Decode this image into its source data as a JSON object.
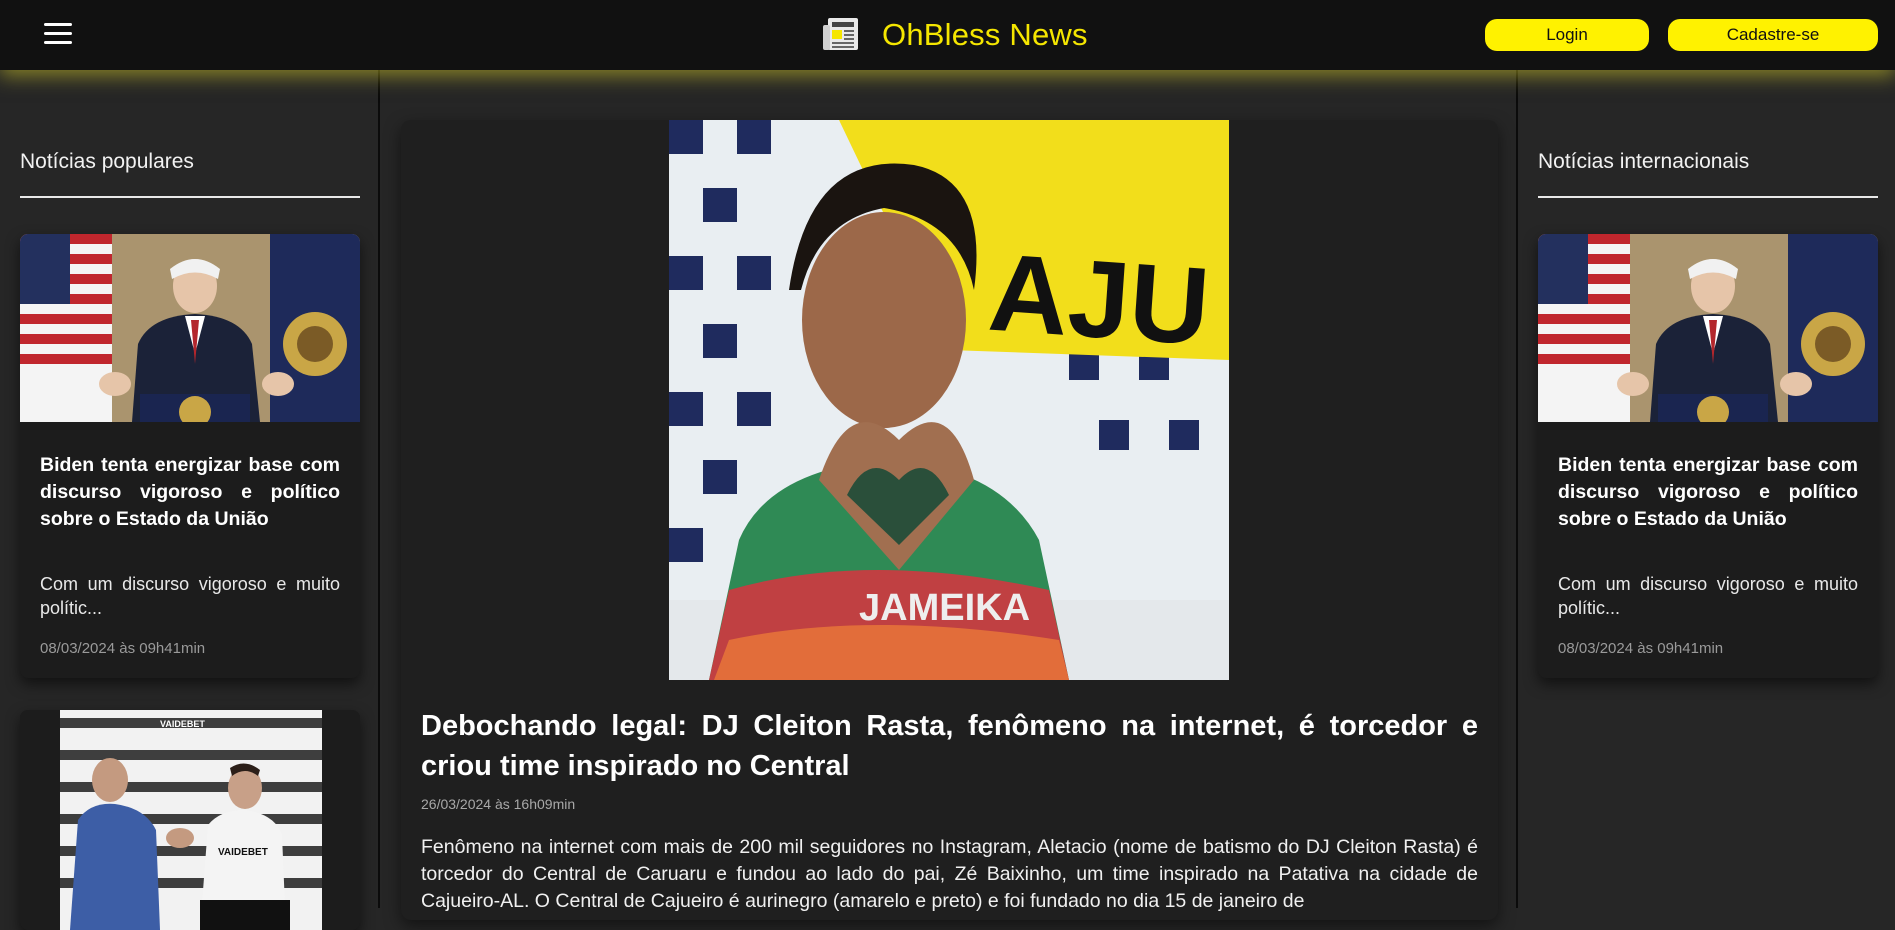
{
  "header": {
    "brand_title": "OhBless News",
    "login_label": "Login",
    "signup_label": "Cadastre-se",
    "accent_color": "#fff200",
    "icons": [
      "menu-icon",
      "newspaper-icon"
    ]
  },
  "left_column": {
    "section_title": "Notícias populares",
    "cards": [
      {
        "title": "Biden tenta energizar base com discurso vigoroso e político sobre o Estado da União",
        "excerpt": "Com um discurso vigoroso e muito polític...",
        "date": "08/03/2024 às 09h41min"
      }
    ]
  },
  "right_column": {
    "section_title": "Notícias internacionais",
    "cards": [
      {
        "title": "Biden tenta energizar base com discurso vigoroso e político sobre o Estado da União",
        "excerpt": "Com um discurso vigoroso e muito polític...",
        "date": "08/03/2024 às 09h41min"
      }
    ]
  },
  "article": {
    "hero_text": "AJU",
    "shirt_text": "JAMEIKA",
    "title": "Debochando legal: DJ Cleiton Rasta, fenômeno na internet, é torcedor e criou time inspirado no Central",
    "date": "26/03/2024 às 16h09min",
    "body": "Fenômeno na internet com mais de 200 mil seguidores no Instagram, Aletacio (nome de batismo do DJ Cleiton Rasta) é torcedor do Central de Caruaru e fundou ao lado do pai, Zé Baixinho, um time inspirado na Patativa na cidade de Cajueiro-AL. O Central de Cajueiro é aurinegro (amarelo e preto) e foi fundado no dia 15 de janeiro de"
  },
  "photo2": {
    "backdrop_text": "VAIDEBET",
    "shirt_text": "VAIDEBET"
  }
}
